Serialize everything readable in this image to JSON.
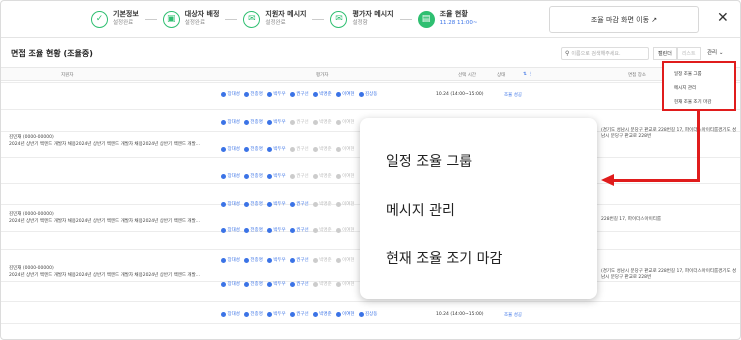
{
  "steps": [
    {
      "icon": "✓",
      "title": "기본정보",
      "sub": "설정완료",
      "active": false
    },
    {
      "icon": "▣",
      "title": "대상자 배정",
      "sub": "설정완료",
      "active": false
    },
    {
      "icon": "✉",
      "title": "지원자 메시지",
      "sub": "설정완료",
      "active": false
    },
    {
      "icon": "✉",
      "title": "평가자 메시지",
      "sub": "설정함",
      "active": false
    },
    {
      "icon": "▤",
      "title": "조율 현황",
      "sub": "11.28 11:00~",
      "active": true
    }
  ],
  "top_button": "조율 마감 화면 이동 ↗",
  "close": "✕",
  "page_title": "면접 조율 현황 (조율중)",
  "search_placeholder": "이름으로 검색해주세요.",
  "seg": {
    "on": "캘린더",
    "off": "리스트"
  },
  "manage_label": "관리 ⌄",
  "columns": {
    "applicant": "지원자",
    "evaluator": "평가자",
    "time": "선택 시간",
    "status": "상태",
    "filter": "⇅ ⋮",
    "location": "면접 장소"
  },
  "applicant_name": "김민재 (0000-00000)",
  "applicant_desc": "2024년 상반기 백엔드 개발자 채용2024년 상반기 백엔드 개발자 채용2024년 상반기 백엔드 개발...",
  "chips_full": [
    "장대성",
    "전종명",
    "박두우",
    "권구선",
    "박명준",
    "이여현",
    "김상동"
  ],
  "chips_partial": [
    "장대성",
    "전종명",
    "박두우",
    "권구선",
    "박명준",
    "이여현"
  ],
  "time_value": "10.24 (14:00~15:00)",
  "status_value": "조율 성공",
  "location_value": "(경기도 성남시 분당구 판교로 228번길 17, 파이더스아이티룸경기도 성남시 분당구 판교로 228번",
  "location_short": "228번길 17, 파이더스아이티룸",
  "dropdown_items": [
    "일정 조율 그룹",
    "메시지 관리",
    "현재 조율 조기 마감"
  ],
  "popup_items": [
    "일정 조율 그룹",
    "메시지 관리",
    "현재 조율 조기 마감"
  ],
  "colors": {
    "accent": "#2fbf71",
    "blue": "#3b73e6",
    "highlight": "#e01c1c"
  }
}
